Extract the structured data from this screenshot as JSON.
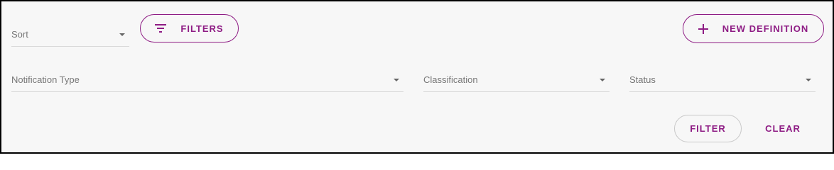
{
  "toolbar": {
    "sort_label": "Sort",
    "filters_label": "FILTERS",
    "new_definition_label": "NEW DEFINITION"
  },
  "filters": {
    "notification_type_label": "Notification Type",
    "classification_label": "Classification",
    "status_label": "Status"
  },
  "actions": {
    "filter_label": "FILTER",
    "clear_label": "CLEAR"
  },
  "icons": {
    "filters": "filter-list-icon",
    "new_definition": "plus-icon",
    "dropdown": "arrow-drop-down-icon"
  },
  "colors": {
    "accent": "#8e1c84",
    "background": "#f7f7f7",
    "label_text": "#777777"
  }
}
